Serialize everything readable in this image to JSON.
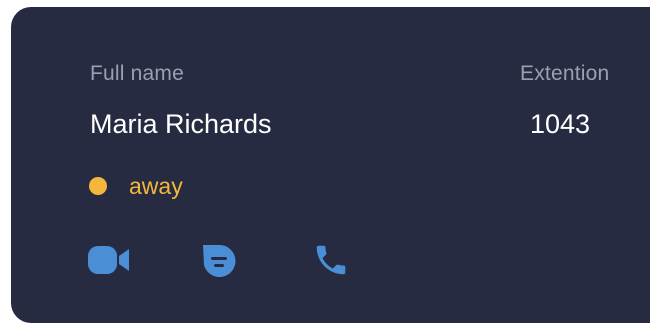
{
  "contact": {
    "full_name_label": "Full name",
    "full_name": "Maria Richards",
    "extension_label": "Extention",
    "extension": "1043",
    "status": "away"
  },
  "actions": [
    {
      "name": "video-call",
      "icon": "video-camera-icon"
    },
    {
      "name": "message",
      "icon": "chat-bubble-icon"
    },
    {
      "name": "phone-call",
      "icon": "phone-icon"
    }
  ],
  "colors": {
    "card_background": "#262b42",
    "label": "#9aa0b2",
    "value": "#ffffff",
    "status_away": "#f5b73b",
    "action_icon": "#4a8fd6"
  }
}
